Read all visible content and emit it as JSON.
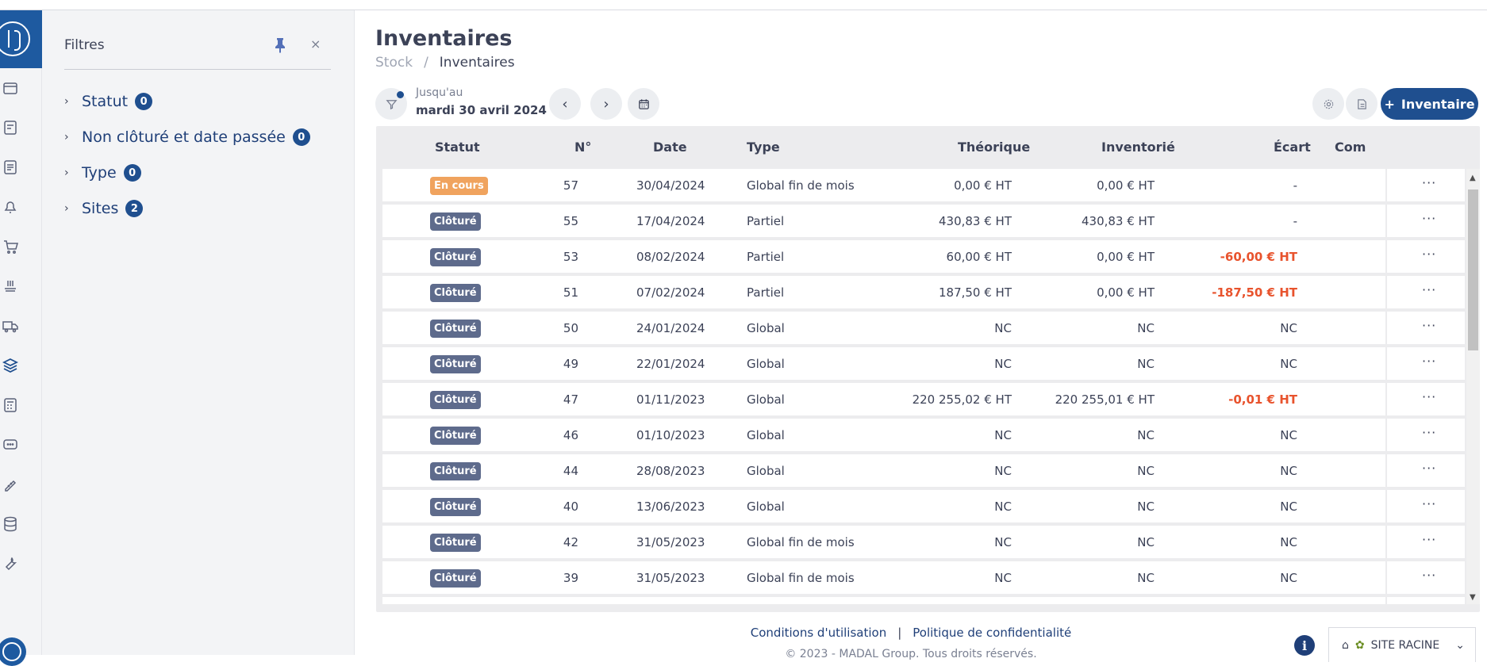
{
  "filters": {
    "title": "Filtres",
    "close": "×",
    "items": [
      {
        "label": "Statut",
        "count": "0"
      },
      {
        "label": "Non clôturé et date passée",
        "count": "0"
      },
      {
        "label": "Type",
        "count": "0"
      },
      {
        "label": "Sites",
        "count": "2"
      }
    ]
  },
  "page": {
    "title": "Inventaires",
    "breadcrumb": [
      "Stock",
      "/",
      "Inventaires"
    ]
  },
  "toolbar": {
    "until_label": "Jusqu'au",
    "until_date": "mardi 30 avril 2024",
    "prev": "‹",
    "next": "›",
    "add_label": "Inventaire",
    "add_plus": "+"
  },
  "table": {
    "headers": [
      "Statut",
      "N°",
      "Date",
      "Type",
      "Théorique",
      "Inventorié",
      "Écart",
      "Com"
    ],
    "rows": [
      {
        "status": "En cours",
        "num": "57",
        "date": "30/04/2024",
        "type": "Global fin de mois",
        "theo": "0,00 € HT",
        "inv": "0,00 € HT",
        "ecart": "-",
        "neg": false
      },
      {
        "status": "Clôturé",
        "num": "55",
        "date": "17/04/2024",
        "type": "Partiel",
        "theo": "430,83 € HT",
        "inv": "430,83 € HT",
        "ecart": "-",
        "neg": false
      },
      {
        "status": "Clôturé",
        "num": "53",
        "date": "08/02/2024",
        "type": "Partiel",
        "theo": "60,00 € HT",
        "inv": "0,00 € HT",
        "ecart": "-60,00 € HT",
        "neg": true
      },
      {
        "status": "Clôturé",
        "num": "51",
        "date": "07/02/2024",
        "type": "Partiel",
        "theo": "187,50 € HT",
        "inv": "0,00 € HT",
        "ecart": "-187,50 € HT",
        "neg": true
      },
      {
        "status": "Clôturé",
        "num": "50",
        "date": "24/01/2024",
        "type": "Global",
        "theo": "NC",
        "inv": "NC",
        "ecart": "NC",
        "neg": false
      },
      {
        "status": "Clôturé",
        "num": "49",
        "date": "22/01/2024",
        "type": "Global",
        "theo": "NC",
        "inv": "NC",
        "ecart": "NC",
        "neg": false
      },
      {
        "status": "Clôturé",
        "num": "47",
        "date": "01/11/2023",
        "type": "Global",
        "theo": "220 255,02 € HT",
        "inv": "220 255,01 € HT",
        "ecart": "-0,01 € HT",
        "neg": true
      },
      {
        "status": "Clôturé",
        "num": "46",
        "date": "01/10/2023",
        "type": "Global",
        "theo": "NC",
        "inv": "NC",
        "ecart": "NC",
        "neg": false
      },
      {
        "status": "Clôturé",
        "num": "44",
        "date": "28/08/2023",
        "type": "Global",
        "theo": "NC",
        "inv": "NC",
        "ecart": "NC",
        "neg": false
      },
      {
        "status": "Clôturé",
        "num": "40",
        "date": "13/06/2023",
        "type": "Global",
        "theo": "NC",
        "inv": "NC",
        "ecart": "NC",
        "neg": false
      },
      {
        "status": "Clôturé",
        "num": "42",
        "date": "31/05/2023",
        "type": "Global fin de mois",
        "theo": "NC",
        "inv": "NC",
        "ecart": "NC",
        "neg": false
      },
      {
        "status": "Clôturé",
        "num": "39",
        "date": "31/05/2023",
        "type": "Global fin de mois",
        "theo": "NC",
        "inv": "NC",
        "ecart": "NC",
        "neg": false
      }
    ],
    "actions": "···"
  },
  "colors": {
    "brand": "#1f4f8f",
    "status_en_cours": "#f0a35e",
    "status_cloture": "#5e6b8c",
    "negative": "#e8532d"
  },
  "footer": {
    "terms": "Conditions d'utilisation",
    "separator": "|",
    "privacy": "Politique de confidentialité",
    "copyright": "© 2023 - MADAL Group. Tous droits réservés."
  },
  "site": {
    "label": "SITE RACINE"
  }
}
